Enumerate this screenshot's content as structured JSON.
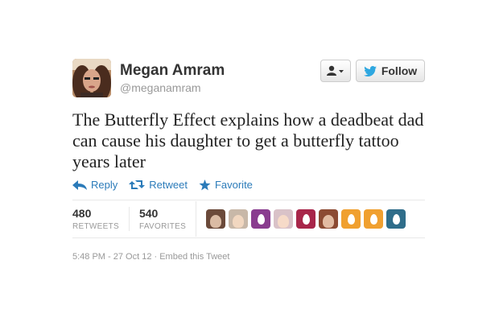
{
  "tweet": {
    "name": "Megan Amram",
    "handle": "@meganamram",
    "text": "The Butterfly Effect explains how a deadbeat dad can cause his daughter to get a butterfly tattoo years later",
    "follow_label": "Follow",
    "actions": {
      "reply": "Reply",
      "retweet": "Retweet",
      "favorite": "Favorite"
    },
    "stats": {
      "retweets_count": "480",
      "retweets_label": "RETWEETS",
      "favorites_count": "540",
      "favorites_label": "FAVORITES"
    },
    "favoriters": [
      {
        "kind": "photo",
        "color": "#6b4a3a"
      },
      {
        "kind": "photo",
        "color": "#c8b8a8"
      },
      {
        "kind": "egg",
        "color": "#8a3d8f"
      },
      {
        "kind": "photo",
        "color": "#d9c2c8"
      },
      {
        "kind": "egg",
        "color": "#a8264a"
      },
      {
        "kind": "photo",
        "color": "#8c4a32"
      },
      {
        "kind": "egg",
        "color": "#f0a030"
      },
      {
        "kind": "egg",
        "color": "#f0a030"
      },
      {
        "kind": "egg",
        "color": "#2f6d8a"
      }
    ],
    "timestamp": "5:48 PM - 27 Oct 12",
    "separator": " · ",
    "embed_label": "Embed this Tweet"
  },
  "colors": {
    "link": "#2b7bb9",
    "twitter_blue": "#2ea7e0"
  },
  "icons": {
    "user_menu": "user-dropdown-icon",
    "follow": "twitter-bird-icon",
    "reply": "reply-arrow-icon",
    "retweet": "retweet-icon",
    "favorite": "star-icon"
  }
}
